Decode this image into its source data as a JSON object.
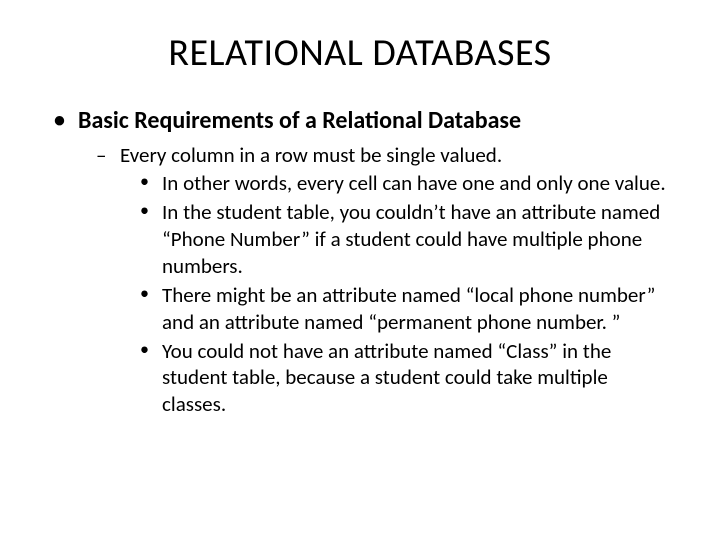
{
  "title": "RELATIONAL DATABASES",
  "bullets": {
    "l1": "Basic Requirements of a Relational Database",
    "l2": "Every column in a row must be single valued.",
    "l3a": "In other words, every cell can have one and only one value.",
    "l3b": "In the student table, you couldn’t have an attribute named “Phone Number” if a student could have multiple phone numbers.",
    "l3c": "There might be an attribute named “local phone number” and an attribute named “permanent phone number. ”",
    "l3d": "You could not have an attribute named “Class” in the student table, because a student could take multiple classes."
  }
}
